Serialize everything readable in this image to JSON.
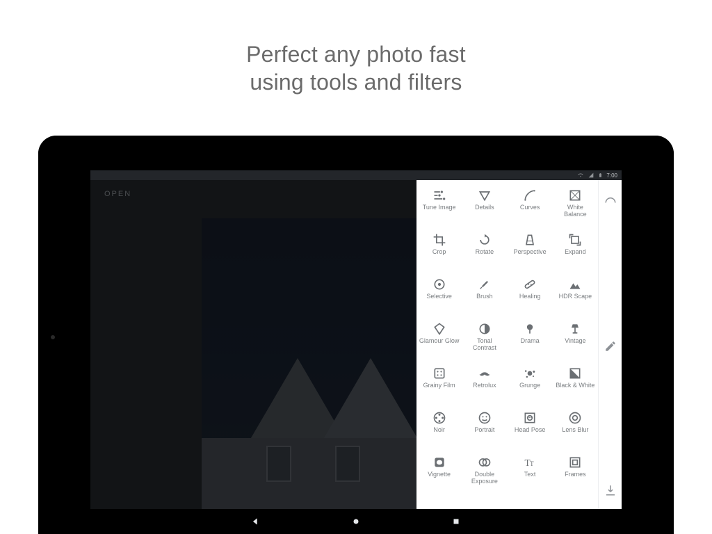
{
  "headline": {
    "line1": "Perfect any photo fast",
    "line2": "using tools and filters"
  },
  "statusbar": {
    "time": "7:00"
  },
  "app": {
    "open_label": "OPEN"
  },
  "rail": {
    "looks_icon": "looks-icon",
    "edit_icon": "pencil-icon",
    "export_icon": "export-icon"
  },
  "tools": [
    {
      "id": "tune-image",
      "label": "Tune Image",
      "icon": "sliders"
    },
    {
      "id": "details",
      "label": "Details",
      "icon": "triangle-down"
    },
    {
      "id": "curves",
      "label": "Curves",
      "icon": "curve"
    },
    {
      "id": "white-balance",
      "label": "White Balance",
      "icon": "wb"
    },
    {
      "id": "crop",
      "label": "Crop",
      "icon": "crop"
    },
    {
      "id": "rotate",
      "label": "Rotate",
      "icon": "rotate"
    },
    {
      "id": "perspective",
      "label": "Perspective",
      "icon": "perspective"
    },
    {
      "id": "expand",
      "label": "Expand",
      "icon": "expand"
    },
    {
      "id": "selective",
      "label": "Selective",
      "icon": "target"
    },
    {
      "id": "brush",
      "label": "Brush",
      "icon": "brush"
    },
    {
      "id": "healing",
      "label": "Healing",
      "icon": "bandage"
    },
    {
      "id": "hdr-scape",
      "label": "HDR Scape",
      "icon": "mountains"
    },
    {
      "id": "glamour-glow",
      "label": "Glamour Glow",
      "icon": "diamond"
    },
    {
      "id": "tonal-contrast",
      "label": "Tonal Contrast",
      "icon": "half-circle"
    },
    {
      "id": "drama",
      "label": "Drama",
      "icon": "tree"
    },
    {
      "id": "vintage",
      "label": "Vintage",
      "icon": "lamp"
    },
    {
      "id": "grainy-film",
      "label": "Grainy Film",
      "icon": "film"
    },
    {
      "id": "retrolux",
      "label": "Retrolux",
      "icon": "moustache"
    },
    {
      "id": "grunge",
      "label": "Grunge",
      "icon": "splatter"
    },
    {
      "id": "black-white",
      "label": "Black & White",
      "icon": "bw-square"
    },
    {
      "id": "noir",
      "label": "Noir",
      "icon": "reel"
    },
    {
      "id": "portrait",
      "label": "Portrait",
      "icon": "face"
    },
    {
      "id": "head-pose",
      "label": "Head Pose",
      "icon": "head-pose"
    },
    {
      "id": "lens-blur",
      "label": "Lens Blur",
      "icon": "blur"
    },
    {
      "id": "vignette",
      "label": "Vignette",
      "icon": "vignette"
    },
    {
      "id": "double-exposure",
      "label": "Double Exposure",
      "icon": "double-exposure"
    },
    {
      "id": "text",
      "label": "Text",
      "icon": "text"
    },
    {
      "id": "frames",
      "label": "Frames",
      "icon": "frames"
    }
  ]
}
